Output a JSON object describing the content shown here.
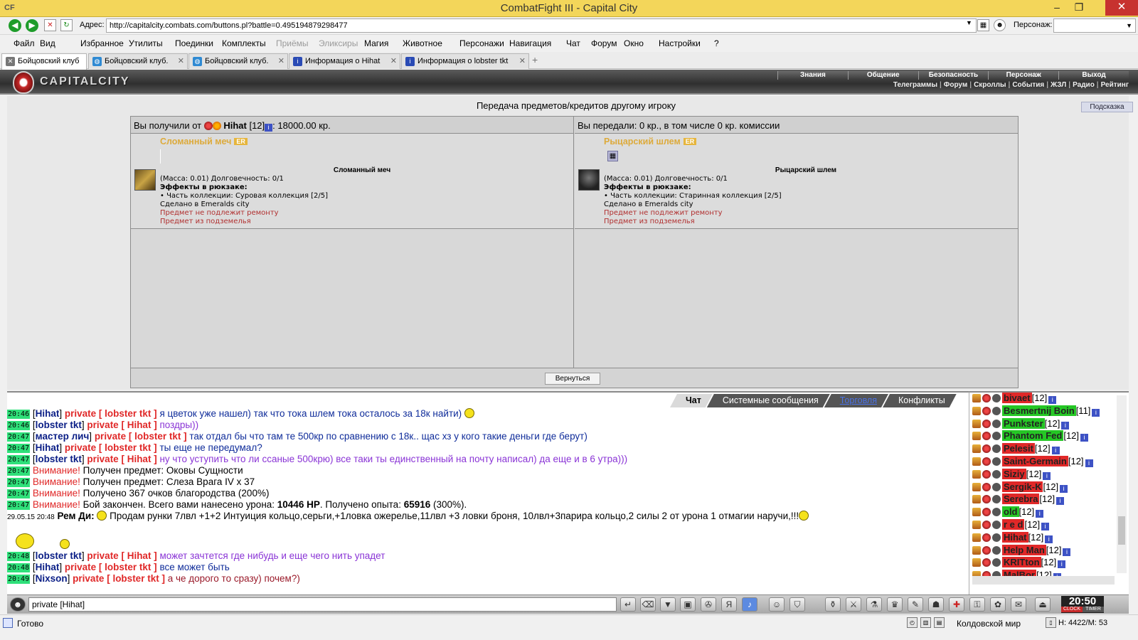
{
  "window": {
    "app_icon_text": "CF",
    "title": "CombatFight III - Capital City"
  },
  "address": {
    "label": "Адрес:",
    "url": "http://capitalcity.combats.com/buttons.pl?battle=0.495194879298477",
    "persona_label": "Персонаж:",
    "persona_value": "▼"
  },
  "menu": [
    {
      "label": "Файл",
      "dim": false
    },
    {
      "label": "Вид",
      "dim": false
    },
    {
      "label": "Избранное",
      "dim": false
    },
    {
      "label": "Утилиты",
      "dim": false
    },
    {
      "label": "Поединки",
      "dim": false
    },
    {
      "label": "Комплекты",
      "dim": false
    },
    {
      "label": "Приёмы",
      "dim": true
    },
    {
      "label": "Эликсиры",
      "dim": true
    },
    {
      "label": "Магия",
      "dim": false
    },
    {
      "label": "Животное",
      "dim": false
    },
    {
      "label": "Персонажи",
      "dim": false
    },
    {
      "label": "Навигация",
      "dim": false
    },
    {
      "label": "Чат",
      "dim": false
    },
    {
      "label": "Форум",
      "dim": false
    },
    {
      "label": "Окно",
      "dim": false
    },
    {
      "label": "Настройки",
      "dim": false
    },
    {
      "label": "?",
      "dim": false
    }
  ],
  "tabs": [
    {
      "label": "Бойцовский клуб",
      "active": true,
      "icon": "sword-icon"
    },
    {
      "label": "Бойцовский клуб.",
      "active": false,
      "icon": "globe-icon"
    },
    {
      "label": "Бойцовский клуб.",
      "active": false,
      "icon": "globe-icon"
    },
    {
      "label": "Информация о Hihat",
      "active": false,
      "icon": "info-icon"
    },
    {
      "label": "Информация о lobster tkt",
      "active": false,
      "icon": "info-icon"
    }
  ],
  "game_header": {
    "logo": "CAPITALCITY",
    "nav": [
      "Знания",
      "Общение",
      "Безопасность",
      "Персонаж",
      "Выход"
    ],
    "subnav": [
      "Телеграммы",
      "Форум",
      "Скроллы",
      "События",
      "ЖЗЛ",
      "Радио",
      "Рейтинг"
    ]
  },
  "transfer": {
    "title": "Передача предметов/кредитов другому игроку",
    "hint_button": "Подсказка",
    "received": {
      "prefix": "Вы получили от",
      "player": "Hihat",
      "level": "[12]",
      "amount": ": 18000.00 кр."
    },
    "given": "Вы передали: 0 кр., в том числе 0 кр. комиссии",
    "return_button": "Вернуться",
    "items_left": {
      "name": "Сломанный меч",
      "badge": "ER",
      "title": "Сломанный меч",
      "lines": [
        "(Масса: 0.01) Долговечность: 0/1",
        "Эффекты в рюкзаке:",
        "• Часть коллекции: Суровая коллекция [2/5]",
        "Сделано в Emeralds city"
      ],
      "red": [
        "Предмет не подлежит ремонту",
        "Предмет из подземелья"
      ]
    },
    "items_right": {
      "name": "Рыцарский шлем",
      "badge": "ER",
      "title": "Рыцарский шлем",
      "lines": [
        "(Масса: 0.01) Долговечность: 0/1",
        "Эффекты в рюкзаке:",
        "• Часть коллекции: Старинная коллекция [2/5]",
        "Сделано в Emeralds city"
      ],
      "red": [
        "Предмет не подлежит ремонту",
        "Предмет из подземелья"
      ]
    }
  },
  "chat": {
    "tabs": [
      {
        "label": "Чат",
        "active": true,
        "link": false
      },
      {
        "label": "Системные сообщения",
        "active": false,
        "link": false
      },
      {
        "label": "Торговля",
        "active": false,
        "link": true
      },
      {
        "label": "Конфликты",
        "active": false,
        "link": false
      }
    ],
    "lines": [
      {
        "time": "20:46",
        "nick": "Hihat",
        "priv": "private [ lobster tkt ]",
        "text": " я цветок уже нашел) так что тока шлем тока осталось за 18к найти)",
        "cls": "msg-blue",
        "smile": true
      },
      {
        "time": "20:46",
        "nick": "lobster tkt",
        "priv": "private [ Hihat ]",
        "text": " поздры))",
        "cls": "msg-purple"
      },
      {
        "time": "20:47",
        "nick": "мастер лич",
        "priv": "private [ lobster tkt ]",
        "text": " так отдал бы что там те 500кр по сравнению с 18к.. щас хз у кого такие деньги где берут)",
        "cls": "msg-blue"
      },
      {
        "time": "20:47",
        "nick": "Hihat",
        "priv": "private [ lobster tkt ]",
        "text": " ты еще не передумал?",
        "cls": "msg-blue"
      },
      {
        "time": "20:47",
        "nick": "lobster tkt",
        "priv": "private [ Hihat ]",
        "text": " ну что уступить что ли ссаные 500крю) все таки ты единственный на почту написал) да еще и в 6 утра)))",
        "cls": "msg-purple"
      },
      {
        "time": "20:47",
        "warn": "Внимание!",
        "text": " Получен предмет: Оковы Сущности"
      },
      {
        "time": "20:47",
        "warn": "Внимание!",
        "text": " Получен предмет: Слеза Врага IV x 37"
      },
      {
        "time": "20:47",
        "warn": "Внимание!",
        "text": " Получено 367 очков благородства (200%)"
      },
      {
        "time": "20:47",
        "warn": "Внимание!",
        "text": " Бой закончен. Всего вами нанесено урона: ",
        "bold1": "10446 HP",
        "text2": ". Получено опыта: ",
        "bold2": "65916",
        "text3": " (300%)."
      }
    ],
    "trade_line": {
      "date": "29.05.15 20:48",
      "nick": "Рем Ди:",
      "text": " Продам рунки 7лвл +1+2 Интуиция кольцо,серьги,+1ловка ожерелье,11лвл +3 ловки броня, 10лвл+3парира кольцо,2 силы 2 от урона 1 отмагии наручи,!!!"
    },
    "lines2": [
      {
        "time": "20:48",
        "nick": "lobster tkt",
        "priv": "private [ Hihat ]",
        "text": " может зачтется где нибудь и еще чего нить упадет",
        "cls": "msg-purple"
      },
      {
        "time": "20:48",
        "nick": "Hihat",
        "priv": "private [ lobster tkt ]",
        "text": " все может быть",
        "cls": "msg-blue"
      },
      {
        "time": "20:49",
        "nick": "Nixson",
        "priv": "private [ lobster tkt ]",
        "text": " а че дорого то сразу) почем?)",
        "cls": "msg-dark"
      }
    ],
    "input_value": "private [Hihat]"
  },
  "users": [
    {
      "name": "bivaet",
      "level": "[12]",
      "bg": "#e02828"
    },
    {
      "name": "Besmertnij Boin",
      "level": "[11]",
      "bg": "#25c725"
    },
    {
      "name": "Punkster",
      "level": "[12]",
      "bg": "#25c725"
    },
    {
      "name": "Phantom Fed",
      "level": "[12]",
      "bg": "#25c725"
    },
    {
      "name": "Pelesit",
      "level": "[12]",
      "bg": "#e02828"
    },
    {
      "name": "Saint-Germain",
      "level": "[12]",
      "bg": "#e02828"
    },
    {
      "name": "Siziy",
      "level": "[12]",
      "bg": "#e02828"
    },
    {
      "name": "Sergik-K",
      "level": "[12]",
      "bg": "#e02828"
    },
    {
      "name": "Serebra",
      "level": "[12]",
      "bg": "#e02828"
    },
    {
      "name": "old",
      "level": "[12]",
      "bg": "#25c725"
    },
    {
      "name": "r e d",
      "level": "[12]",
      "bg": "#e02828"
    },
    {
      "name": "Hihat",
      "level": "[12]",
      "bg": "#e02828"
    },
    {
      "name": "Help Man",
      "level": "[12]",
      "bg": "#e02828"
    },
    {
      "name": "KRITton",
      "level": "[12]",
      "bg": "#e02828"
    },
    {
      "name": "MalBor",
      "level": "[12]",
      "bg": "#e02828"
    }
  ],
  "clock": {
    "time": "20:50",
    "clock_label": "CLOCK",
    "timer_label": "TIMER"
  },
  "status": {
    "text": "Готово",
    "world": "Колдовской мир",
    "coords": "H: 4422/M: 53"
  }
}
